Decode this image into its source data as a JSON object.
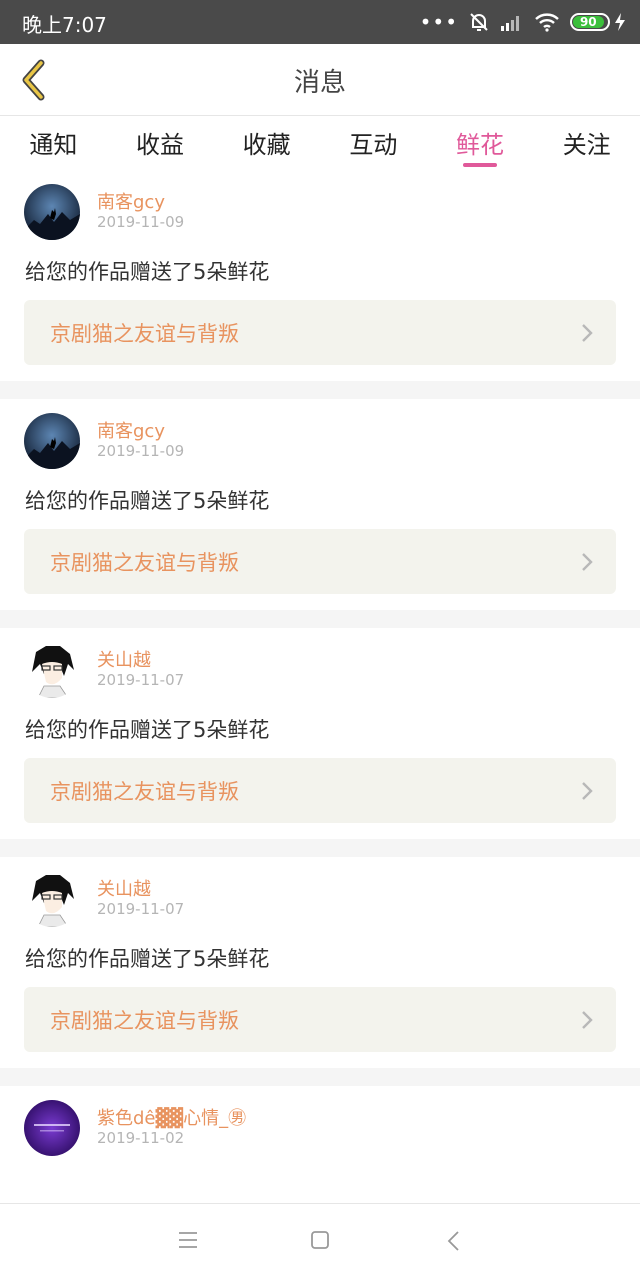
{
  "status_bar": {
    "time": "晚上7:07",
    "battery": "90",
    "dots": "•••"
  },
  "header": {
    "title": "消息",
    "back_icon": "chevron-left-icon"
  },
  "tabs": [
    {
      "label": "通知",
      "active": false
    },
    {
      "label": "收益",
      "active": false
    },
    {
      "label": "收藏",
      "active": false
    },
    {
      "label": "互动",
      "active": false
    },
    {
      "label": "鲜花",
      "active": true
    },
    {
      "label": "关注",
      "active": false
    }
  ],
  "colors": {
    "accent": "#e0599a",
    "name": "#e8935f",
    "date": "#b5b5b5",
    "card_bg": "#f3f3ed"
  },
  "messages": [
    {
      "username": "南客gcy",
      "date": "2019-11-09",
      "text": "给您的作品赠送了5朵鲜花",
      "work_title": "京剧猫之友谊与背叛",
      "avatar": "wolf-night-avatar"
    },
    {
      "username": "南客gcy",
      "date": "2019-11-09",
      "text": "给您的作品赠送了5朵鲜花",
      "work_title": "京剧猫之友谊与背叛",
      "avatar": "wolf-night-avatar"
    },
    {
      "username": "关山越",
      "date": "2019-11-07",
      "text": "给您的作品赠送了5朵鲜花",
      "work_title": "京剧猫之友谊与背叛",
      "avatar": "anime-boy-avatar"
    },
    {
      "username": "关山越",
      "date": "2019-11-07",
      "text": "给您的作品赠送了5朵鲜花",
      "work_title": "京剧猫之友谊与背叛",
      "avatar": "anime-boy-avatar"
    },
    {
      "username": "紫色dê▓▓心情_㊚",
      "date": "2019-11-02",
      "avatar": "purple-avatar"
    }
  ],
  "nav": {
    "menu_icon": "menu-icon",
    "home_icon": "home-icon",
    "back_icon": "back-icon"
  }
}
